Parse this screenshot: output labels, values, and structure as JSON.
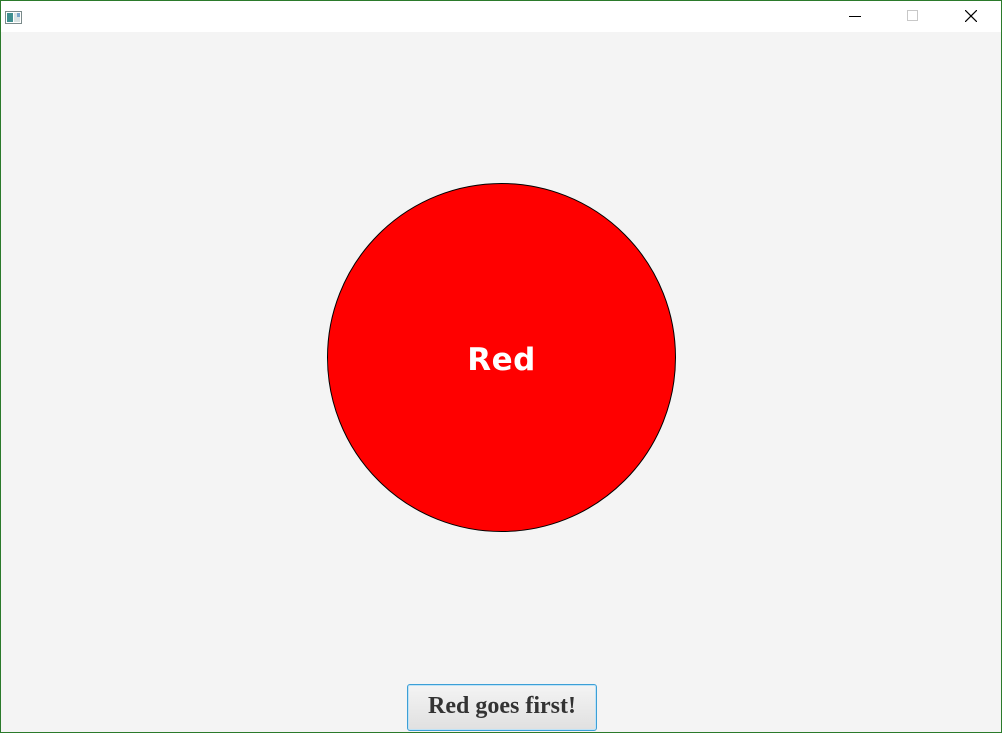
{
  "window": {
    "title": "",
    "controls": {
      "minimize_icon": "minimize-icon",
      "maximize_icon": "maximize-icon",
      "close_icon": "close-icon"
    }
  },
  "light": {
    "label": "Red",
    "color": "#ff0000",
    "text_color": "#ffffff"
  },
  "action": {
    "button_label": "Red goes first!"
  },
  "colors": {
    "window_border": "#2b7a2b",
    "background": "#f4f4f4",
    "button_focus_border": "#3c9fd6"
  }
}
